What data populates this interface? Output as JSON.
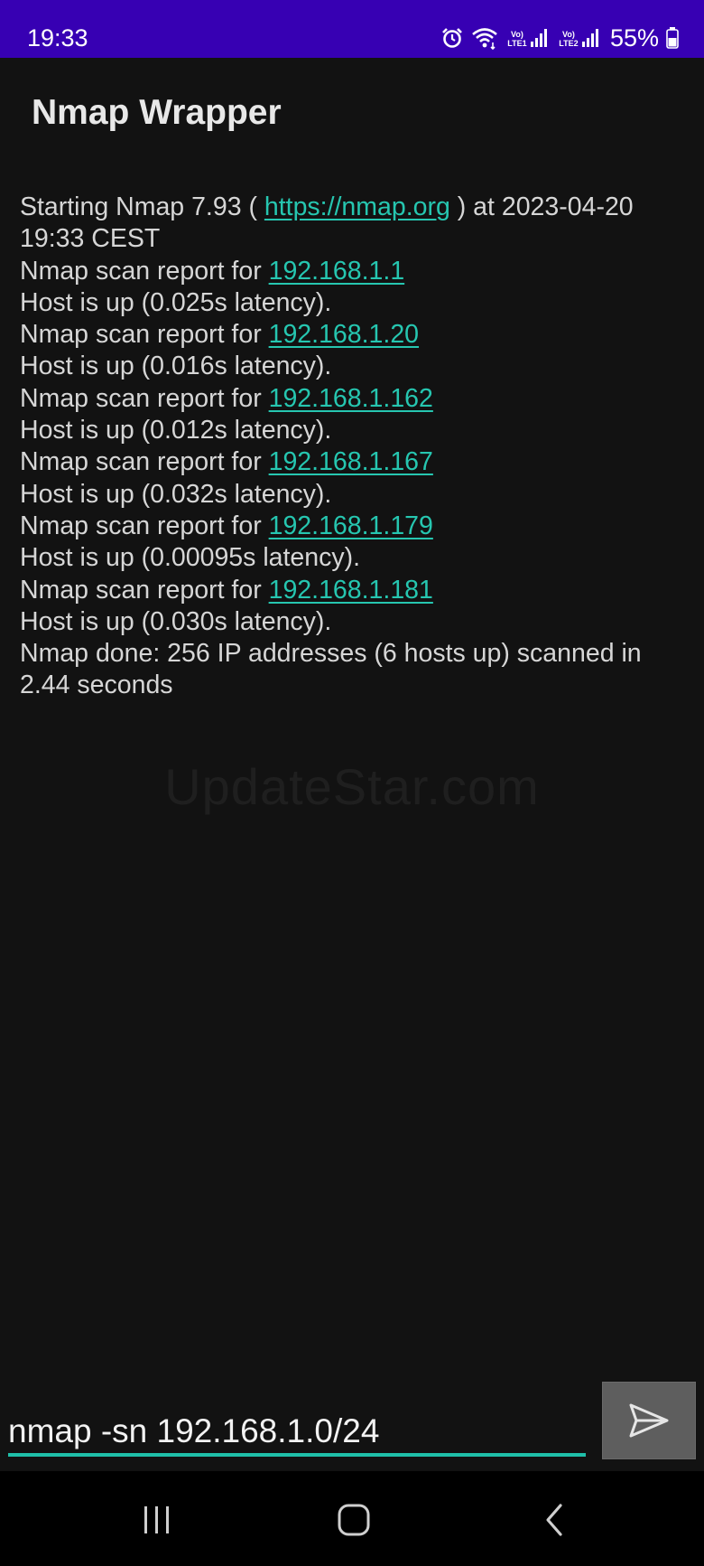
{
  "status_bar": {
    "time": "19:33",
    "sim1_label": "Vo) LTE1",
    "sim2_label": "Vo) LTE2",
    "battery": "55%",
    "background": "#3700b3"
  },
  "app_bar": {
    "title": "Nmap Wrapper"
  },
  "output": {
    "line1_prefix": "Starting Nmap 7.93 ( ",
    "line1_link": "https://nmap.org",
    "line1_suffix": " ) at 2023-04-20 19:33 CEST",
    "reports": [
      {
        "prefix": "Nmap scan report for ",
        "ip": "192.168.1.1",
        "status": "Host is up (0.025s latency)."
      },
      {
        "prefix": "Nmap scan report for ",
        "ip": "192.168.1.20",
        "status": "Host is up (0.016s latency)."
      },
      {
        "prefix": "Nmap scan report for ",
        "ip": "192.168.1.162",
        "status": "Host is up (0.012s latency)."
      },
      {
        "prefix": "Nmap scan report for ",
        "ip": "192.168.1.167",
        "status": "Host is up (0.032s latency)."
      },
      {
        "prefix": "Nmap scan report for ",
        "ip": "192.168.1.179",
        "status": "Host is up (0.00095s latency)."
      },
      {
        "prefix": "Nmap scan report for ",
        "ip": "192.168.1.181",
        "status": "Host is up (0.030s latency)."
      }
    ],
    "summary": "Nmap done: 256 IP addresses (6 hosts up) scanned in 2.44 seconds",
    "link_color": "#26c6b0"
  },
  "watermark": "UpdateStar.com",
  "input": {
    "value": "nmap -sn 192.168.1.0/24",
    "accent_color": "#1fbfa9"
  },
  "icons": {
    "send": "send-icon",
    "recents": "recents-icon",
    "home": "home-icon",
    "back": "back-icon"
  }
}
